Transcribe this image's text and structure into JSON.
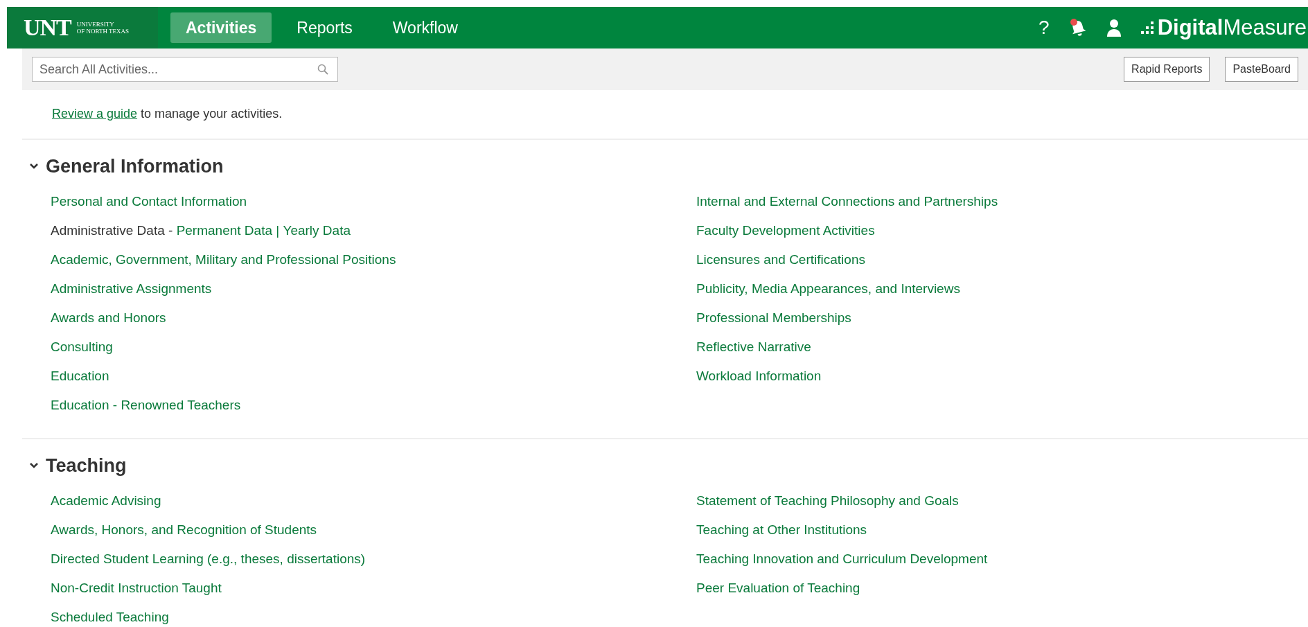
{
  "header": {
    "logo": {
      "mark": "UNT",
      "sub_line_1": "UNIVERSITY",
      "sub_line_2": "OF NORTH TEXAS"
    },
    "tabs": [
      {
        "label": "Activities",
        "selected": true
      },
      {
        "label": "Reports",
        "selected": false
      },
      {
        "label": "Workflow",
        "selected": false
      }
    ],
    "help": "?",
    "notifications": {
      "unread": true
    },
    "brand": "**Digital**Measure"
  },
  "toolbar": {
    "search": {
      "placeholder": "Search All Activities..."
    },
    "buttons": [
      "Rapid Reports",
      "PasteBoard"
    ]
  },
  "intro": {
    "link": "Review a guide",
    "text": " to manage your activities."
  },
  "sections": [
    {
      "title": "General Information",
      "expanded": true,
      "columns": [
        [
          {
            "kind": "link",
            "label": "Personal and Contact Information"
          },
          {
            "kind": "split",
            "label": "Administrative Data - ",
            "links": [
              "Permanent Data",
              "Yearly Data"
            ],
            "separator": " | "
          },
          {
            "kind": "link",
            "label": "Academic, Government, Military and Professional Positions"
          },
          {
            "kind": "link",
            "label": "Administrative Assignments"
          },
          {
            "kind": "link",
            "label": "Awards and Honors"
          },
          {
            "kind": "link",
            "label": "Consulting"
          },
          {
            "kind": "link",
            "label": "Education"
          },
          {
            "kind": "link",
            "label": "Education - Renowned Teachers"
          }
        ],
        [
          {
            "kind": "link",
            "label": "Internal and External Connections and Partnerships"
          },
          {
            "kind": "link",
            "label": "Faculty Development Activities"
          },
          {
            "kind": "link",
            "label": "Licensures and Certifications"
          },
          {
            "kind": "link",
            "label": "Publicity, Media Appearances, and Interviews"
          },
          {
            "kind": "link",
            "label": "Professional Memberships"
          },
          {
            "kind": "link",
            "label": "Reflective Narrative"
          },
          {
            "kind": "link",
            "label": "Workload Information"
          }
        ]
      ]
    },
    {
      "title": "Teaching",
      "expanded": true,
      "columns": [
        [
          {
            "kind": "link",
            "label": "Academic Advising"
          },
          {
            "kind": "link",
            "label": "Awards, Honors, and Recognition of Students"
          },
          {
            "kind": "link",
            "label": "Directed Student Learning (e.g., theses, dissertations)"
          },
          {
            "kind": "link",
            "label": "Non-Credit Instruction Taught"
          },
          {
            "kind": "link",
            "label": "Scheduled Teaching"
          }
        ],
        [
          {
            "kind": "link",
            "label": "Statement of Teaching Philosophy and Goals"
          },
          {
            "kind": "link",
            "label": "Teaching at Other Institutions"
          },
          {
            "kind": "link",
            "label": "Teaching Innovation and Curriculum Development"
          },
          {
            "kind": "link",
            "label": "Peer Evaluation of Teaching"
          }
        ]
      ]
    }
  ]
}
